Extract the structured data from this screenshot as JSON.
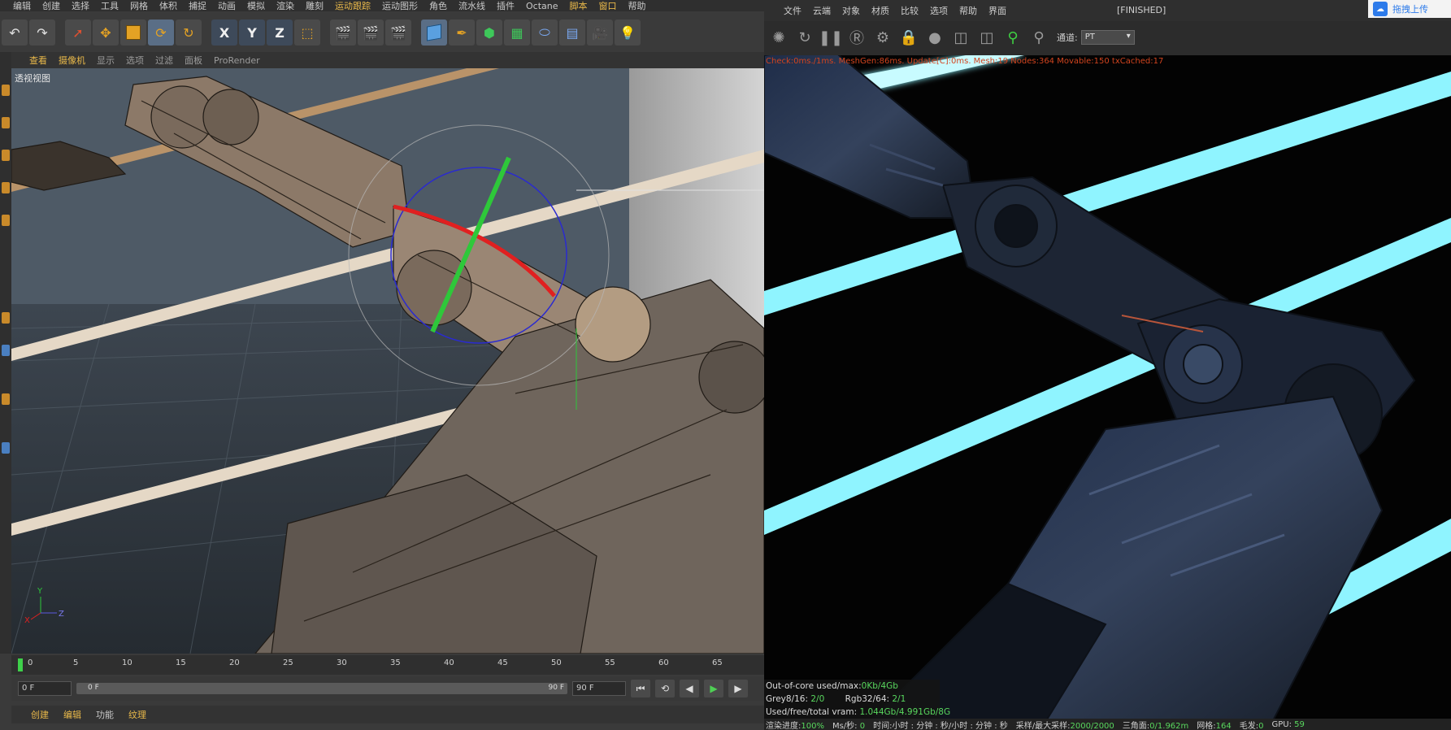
{
  "c4d": {
    "menu": [
      "编辑",
      "创建",
      "选择",
      "工具",
      "网格",
      "体积",
      "捕捉",
      "动画",
      "模拟",
      "渲染",
      "雕刻",
      "运动跟踪",
      "运动图形",
      "角色",
      "流水线",
      "插件",
      "Octane",
      "脚本",
      "窗口",
      "帮助"
    ],
    "axis_x": "X",
    "axis_y": "Y",
    "axis_z": "Z",
    "view_menu": [
      "查看",
      "摄像机",
      "显示",
      "选项",
      "过滤",
      "面板",
      "ProRender"
    ],
    "viewport_label": "透视视图",
    "axis_gizmo": {
      "y": "Y",
      "x": "X",
      "z": "Z"
    },
    "timeline_ticks": [
      "0",
      "5",
      "10",
      "15",
      "20",
      "25",
      "30",
      "35",
      "40",
      "45",
      "50",
      "55",
      "60",
      "65"
    ],
    "start_frame": "0 F",
    "slider_left": "0 F",
    "slider_right": "90 F",
    "end_frame": "90 F",
    "bottom_menu": [
      "创建",
      "编辑",
      "功能",
      "纹理"
    ],
    "colors": {
      "accent": "#e8b84a",
      "axis_x": "#e02020",
      "axis_y": "#2ec83a",
      "axis_z": "#2a2ad0"
    }
  },
  "octane": {
    "menu": [
      "文件",
      "云端",
      "对象",
      "材质",
      "比较",
      "选项",
      "帮助",
      "界面"
    ],
    "status": "[FINISHED]",
    "upload_label": "拖拽上传",
    "channel_label": "通道:",
    "channel_value": "PT",
    "stats": "Check:0ms./1ms. MeshGen:86ms. Update[C]:0ms. Mesh:19 Nodes:364 Movable:150 txCached:17",
    "ooc": {
      "line1_label": "Out-of-core used/max:",
      "line1_value": "0Kb/4Gb",
      "grey_label": "Grey8/16: ",
      "grey_value": "2/0",
      "rgb_label": "Rgb32/64: ",
      "rgb_value": "2/1",
      "vram_label": "Used/free/total vram: ",
      "vram_value": "1.044Gb/4.991Gb/8G"
    },
    "bottom": {
      "progress_label": "渲染进度:",
      "progress_value": "100%",
      "mss_label": "Ms/秒:",
      "mss_value": "0",
      "time_label": "时间:小时 : 分钟 : 秒/小时 : 分钟 : 秒",
      "samples_label": "采样/最大采样:",
      "samples_value": "2000/2000",
      "tri_label": "三角面:",
      "tri_value": "0/1.962m",
      "mesh_label": "网格:",
      "mesh_value": "164",
      "hair_label": "毛发:",
      "hair_value": "0",
      "gpu_label": "GPU:",
      "gpu_value": "59"
    },
    "colors": {
      "stats": "#d2441e",
      "value": "#59d85e",
      "light": "#8ff4ff"
    }
  }
}
